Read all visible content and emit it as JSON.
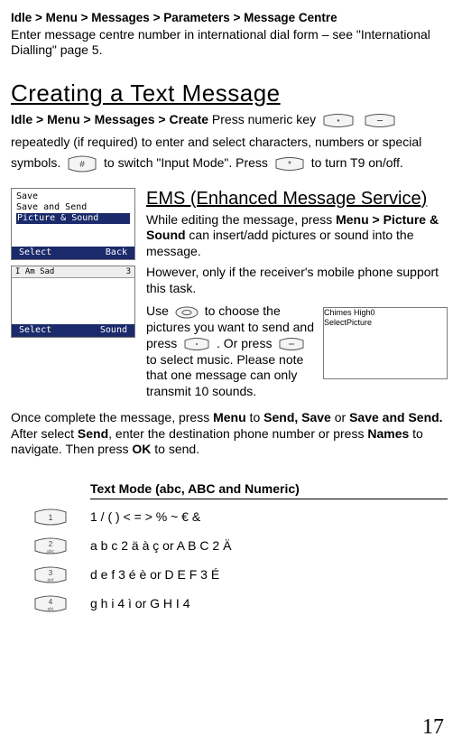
{
  "nav1": "Idle > Menu > Messages > Parameters > Message Centre",
  "intro1": "Enter message centre number in international dial form – see \"International Dialling\" page 5.",
  "h1": "Creating a Text Message",
  "create_nav": "Idle > Menu > Messages > Create",
  "create_1": "  Press numeric key  ",
  "create_2": "  repeatedly (if required) to enter and select characters, numbers or special symbols.  ",
  "create_3": "  to switch \"Input Mode\". Press ",
  "create_4": "  to turn T9 on/off.",
  "ems_h": "EMS (Enhanced Message Service)",
  "ems_p1a": "While editing the message, press ",
  "ems_p1b": "Menu > Picture & Sound",
  "ems_p1c": " can insert/add pictures or sound into the message.",
  "ems_p2": "However, only if the receiver's mobile phone support this task.",
  "ems_p3a": "Use ",
  "ems_p3b": " to choose the pictures you want to send and press ",
  "ems_p3c": " .  Or press  ",
  "ems_p3d": " to select music. Please note that one message can only transmit 10 sounds.",
  "fin_a": "Once complete the message, press ",
  "fin_b": "Menu",
  "fin_c": " to ",
  "fin_d": "Send, Save",
  "fin_e": " or ",
  "fin_f": "Save and Send.",
  "fin_g": "  After select ",
  "fin_h": "Send",
  "fin_i": ", enter the destination phone number or press ",
  "fin_j": "Names",
  "fin_k": " to navigate. Then press ",
  "fin_l": "OK",
  "fin_m": " to send.",
  "tbl_head": "Text Mode (abc, ABC and Numeric)",
  "rows": [
    "1 / (  ) <  =  > %  ~  €  &",
    "a b c 2 ä à ç or A B C  2 Ä",
    "d e f 3 é è or D E F 3 É",
    "g h i 4 ì or G H I 4"
  ],
  "shots": {
    "a": {
      "l1": "Save",
      "l2": "Save and Send",
      "l3": "Picture & Sound",
      "left": "Select",
      "right": "Back"
    },
    "b": {
      "top_l": "I Am Sad",
      "top_r": "3",
      "left": "Select",
      "right": "Sound"
    },
    "c": {
      "top_l": "Chimes High",
      "top_r": "0",
      "left": "Select",
      "right": "Picture"
    }
  },
  "pagenum": "17"
}
